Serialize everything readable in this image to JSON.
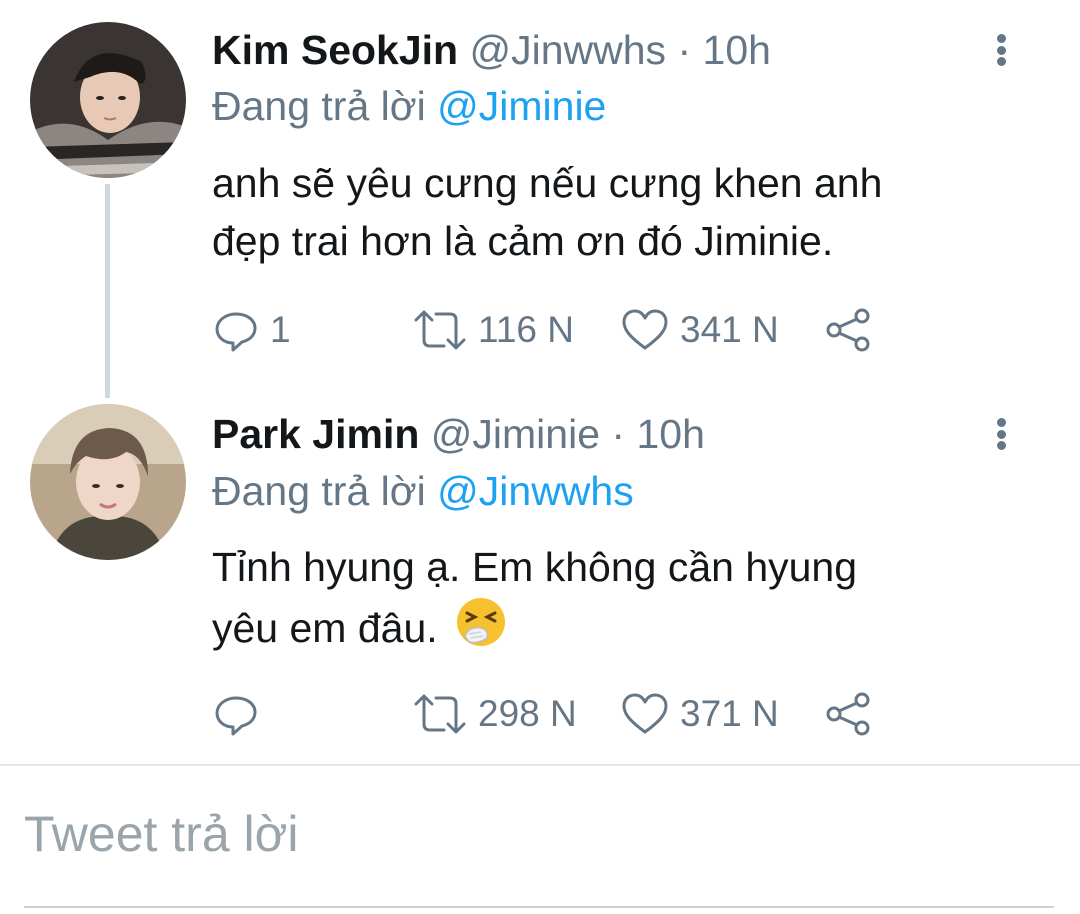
{
  "tweets": [
    {
      "name": "Kim SeokJin",
      "handle": "@Jinwwhs",
      "separator": "·",
      "time": "10h",
      "replying_prefix": "Đang trả lời",
      "replying_to": "@Jiminie",
      "text_line1": "anh sẽ yêu cưng nếu cưng khen anh",
      "text_line2": "đẹp trai hơn là cảm ơn đó Jiminie.",
      "replies": "1",
      "retweets": "116 N",
      "likes": "341 N",
      "avatar_icon": "avatar-photo-icon"
    },
    {
      "name": "Park Jimin",
      "handle": "@Jiminie",
      "separator": "·",
      "time": "10h",
      "replying_prefix": "Đang trả lời",
      "replying_to": "@Jinwwhs",
      "text_line1": "Tỉnh hyung ạ. Em không cần hyung",
      "text_line2": "yêu em đâu.",
      "emoji_icon": "sneezing-face-icon",
      "replies": "",
      "retweets": "298 N",
      "likes": "371 N",
      "avatar_icon": "avatar-photo-icon"
    }
  ],
  "compose": {
    "placeholder": "Tweet trả lời"
  },
  "colors": {
    "link": "#1da1f2",
    "muted": "#657786",
    "text": "#14171a",
    "placeholder": "#9aa4ab"
  }
}
